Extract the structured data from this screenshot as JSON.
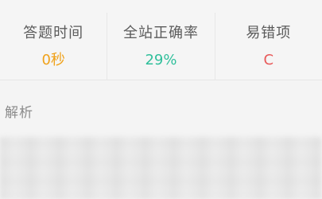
{
  "stats": [
    {
      "label": "答题时间",
      "value": "0秒",
      "color": "#f0a21b"
    },
    {
      "label": "全站正确率",
      "value": "29%",
      "color": "#2fbf9b"
    },
    {
      "label": "易错项",
      "value": "C",
      "color": "#e85a5a"
    }
  ],
  "analysis": {
    "title": "解析"
  }
}
